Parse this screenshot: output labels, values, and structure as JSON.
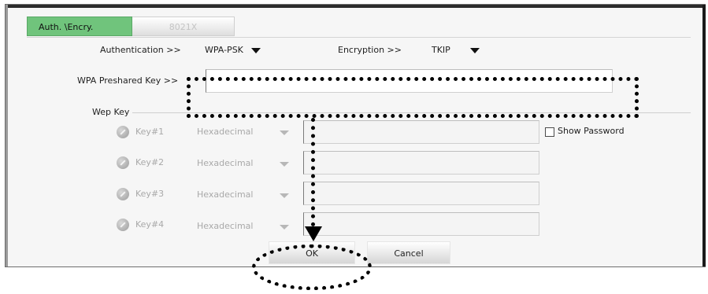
{
  "tabs": [
    {
      "label": "Auth. \\Encry.",
      "active": true
    },
    {
      "label": "8021X",
      "active": false
    }
  ],
  "authentication": {
    "label": "Authentication >>",
    "value": "WPA-PSK"
  },
  "encryption": {
    "label": "Encryption >>",
    "value": "TKIP"
  },
  "wpa_key": {
    "label": "WPA Preshared Key >>",
    "value": ""
  },
  "wep": {
    "label": "Wep Key",
    "keys": [
      {
        "label": "Key#1",
        "format": "Hexadecimal",
        "value": ""
      },
      {
        "label": "Key#2",
        "format": "Hexadecimal",
        "value": ""
      },
      {
        "label": "Key#3",
        "format": "Hexadecimal",
        "value": ""
      },
      {
        "label": "Key#4",
        "format": "Hexadecimal",
        "value": ""
      }
    ],
    "show_password": {
      "label": "Show Password",
      "checked": false
    }
  },
  "buttons": {
    "ok": "OK",
    "cancel": "Cancel"
  },
  "colors": {
    "active_tab": "#70c47c",
    "annotation": "#000000"
  }
}
